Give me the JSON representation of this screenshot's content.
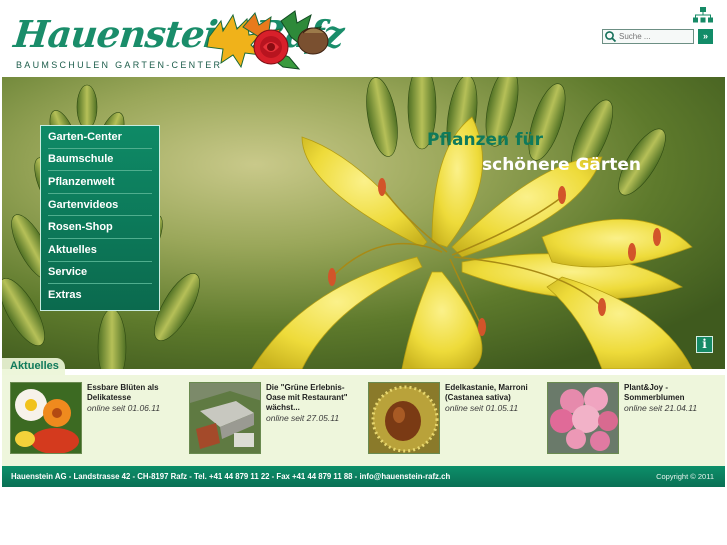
{
  "brand": {
    "name": "Hauenstein Rafz",
    "subtitle": "BAUMSCHULEN  GARTEN-CENTER",
    "accent_color": "#128c68"
  },
  "header": {
    "sitemap_icon": "sitemap-icon",
    "search": {
      "placeholder": "Suche ...",
      "go_label": "»",
      "icon": "search-icon"
    }
  },
  "hero": {
    "tagline_line1": "Pflanzen für",
    "tagline_line2": "schönere Gärten",
    "info_label": "i"
  },
  "nav": {
    "items": [
      {
        "label": "Garten-Center"
      },
      {
        "label": "Baumschule"
      },
      {
        "label": "Pflanzenwelt"
      },
      {
        "label": "Gartenvideos"
      },
      {
        "label": "Rosen-Shop"
      },
      {
        "label": "Aktuelles"
      },
      {
        "label": "Service"
      },
      {
        "label": "Extras"
      }
    ]
  },
  "news": {
    "title": "Aktuelles",
    "items": [
      {
        "line1": "Essbare Blüten als",
        "line2": "Delikatesse",
        "line3": "",
        "date": "online seit 01.06.11"
      },
      {
        "line1": "Die \"Grüne Erlebnis-",
        "line2": "Oase mit Restaurant\"",
        "line3": "wächst...",
        "date": "online seit 27.05.11"
      },
      {
        "line1": "Edelkastanie, Marroni",
        "line2": "(Castanea sativa)",
        "line3": "",
        "date": "online seit 01.05.11"
      },
      {
        "line1": "Plant&Joy -",
        "line2": "Sommerblumen",
        "line3": "",
        "date": "online seit 21.04.11"
      }
    ]
  },
  "footer": {
    "address": "Hauenstein AG - Landstrasse 42 - CH-8197 Rafz - Tel. +41 44 879 11 22 - Fax +41 44 879 11 88 - info@hauenstein-rafz.ch",
    "copyright": "Copyright © 2011"
  }
}
